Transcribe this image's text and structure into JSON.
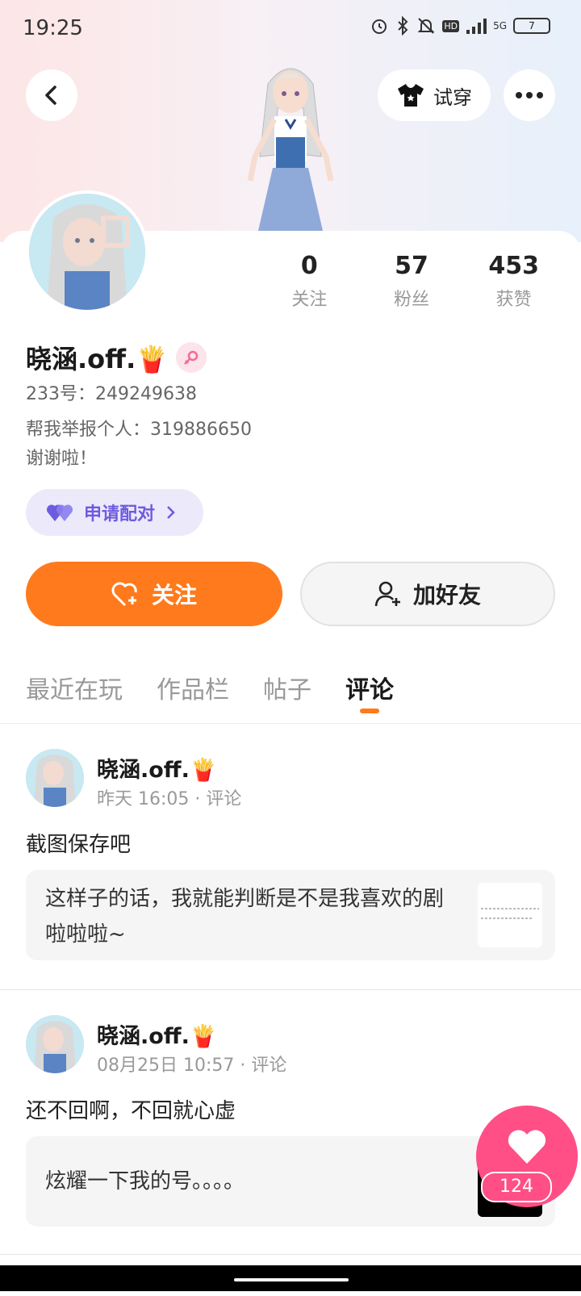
{
  "status_bar": {
    "time": "19:25",
    "battery": "7",
    "network": "5G",
    "hd_badge": "HD"
  },
  "header": {
    "try_on_label": "试穿",
    "icons": [
      "back-arrow-icon",
      "tshirt-icon",
      "more-icon"
    ]
  },
  "profile": {
    "name": "晓涵.off.",
    "name_emoji": "🍟",
    "gender_symbol": "⚦",
    "id_line": "233号：249249638",
    "bio_line1": "帮我举报个人：319886650",
    "bio_line2": "谢谢啦！",
    "pair_chip_label": "申请配对"
  },
  "stats": [
    {
      "value": "0",
      "label": "关注"
    },
    {
      "value": "57",
      "label": "粉丝"
    },
    {
      "value": "453",
      "label": "获赞"
    }
  ],
  "actions": {
    "follow_label": "关注",
    "add_friend_label": "加好友"
  },
  "tabs": [
    {
      "label": "最近在玩",
      "active": false
    },
    {
      "label": "作品栏",
      "active": false
    },
    {
      "label": "帖子",
      "active": false
    },
    {
      "label": "评论",
      "active": true
    }
  ],
  "posts": [
    {
      "name": "晓涵.off.",
      "emoji": "🍟",
      "meta": "昨天 16:05 · 评论",
      "text": "截图保存吧",
      "quote": "这样子的话，我就能判断是不是我喜欢的剧啦啦啦~"
    },
    {
      "name": "晓涵.off.",
      "emoji": "🍟",
      "meta": "08月25日 10:57 · 评论",
      "text": "还不回啊，不回就心虚",
      "quote": "炫耀一下我的号。。。。"
    }
  ],
  "like_fab": {
    "count": "124"
  },
  "colors": {
    "accent": "#ff7a1c",
    "like": "#ff4f86",
    "pair": "#6d5be0"
  }
}
